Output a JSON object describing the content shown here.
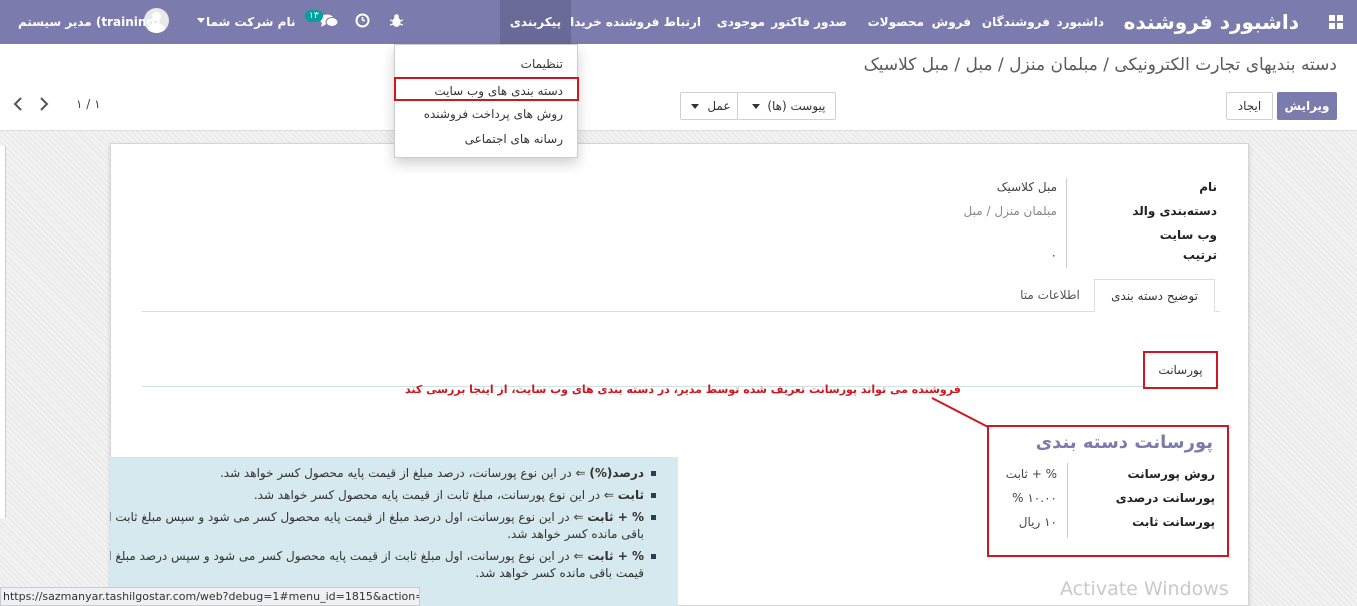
{
  "navbar": {
    "app_title": "داشبورد فروشنده",
    "menu": [
      "داشبورد",
      "فروشندگان",
      "فروش",
      "محصولات",
      "صدور فاکتور",
      "موجودی",
      "ارتباط فروشنده خریدار",
      "پیکربندی"
    ],
    "active_menu": "پیکربندی",
    "company": "نام شرکت شما",
    "user": "مدیر سیستم (training)",
    "messages_badge": "۱۳",
    "icons": [
      "apps-grid-icon",
      "bug-icon",
      "clock-icon",
      "chat-icon",
      "user-avatar"
    ],
    "colors": {
      "brand": "#7c7bad",
      "active": "#6a6a99",
      "badge": "#00a09d"
    }
  },
  "dropdown": {
    "items": [
      "تنظیمات",
      "دسته بندی های وب سایت",
      "روش های پرداخت فروشنده",
      "رسانه های اجتماعی"
    ],
    "highlighted_index": 1
  },
  "breadcrumb": "دسته بندیهای تجارت الکترونیکی / مبلمان منزل / مبل / مبل کلاسیک",
  "toolbar": {
    "edit": "ویرایش",
    "create": "ایجاد",
    "attachments": "پیوست (ها)",
    "action": "عمل",
    "pager": "۱ / ۱"
  },
  "form": {
    "fields": {
      "name_label": "نام",
      "name_value": "مبل کلاسیک",
      "parent_label": "دسته‌بندی والد",
      "parent_value": "مبلمان منزل / مبل",
      "website_label": "وب سایت",
      "sequence_label": "ترتیب",
      "sequence_value": "۰"
    },
    "tabs": [
      "توضیح دسته بندی",
      "اطلاعات متا"
    ],
    "active_tab": "توضیح دسته بندی",
    "commission_button": "پورسانت"
  },
  "annotation": "فروشنده می تواند پورسانت تعریف شده توسط مدیر، در دسته بندی های وب سایت، از اینجا بررسی کند",
  "commission_panel": {
    "title": "پورسانت دسته بندی",
    "method_label": "روش پورسانت",
    "method_value": "% + ثابت",
    "percent_label": "پورسانت درصدی",
    "percent_value": "۱۰.۰۰ %",
    "fixed_label": "پورسانت ثابت",
    "fixed_value": "۱۰ ریال"
  },
  "help": {
    "items": [
      {
        "term": "درصد(%)",
        "text": " ⇐ در این نوع پورسانت، درصد مبلغ از قیمت پایه محصول کسر خواهد شد."
      },
      {
        "term": "ثابت",
        "text": " ⇐ در این نوع پورسانت، مبلغ ثابت از قیمت پایه محصول کسر خواهد شد."
      },
      {
        "term": "% + ثابت",
        "text": " ⇐ در این نوع پورسانت، اول درصد مبلغ از قیمت پایه محصول کسر می شود و سپس مبلغ ثابت از مبلغ باقی مانده کسر خواهد شد."
      },
      {
        "term": "% + ثابت",
        "text": " ⇐ در این نوع پورسانت، اول مبلغ ثابت از قیمت پایه محصول کسر می شود و سپس درصد مبلغ از قیمت باقی مانده کسر خواهد شد."
      }
    ]
  },
  "statusbar_url": "https://sazmanyar.tashilgostar.com/web?debug=1#menu_id=1815&action=417",
  "watermark": "Activate Windows",
  "colors": {
    "highlight": "#d0161f",
    "help_bg": "#d5e9ee"
  }
}
